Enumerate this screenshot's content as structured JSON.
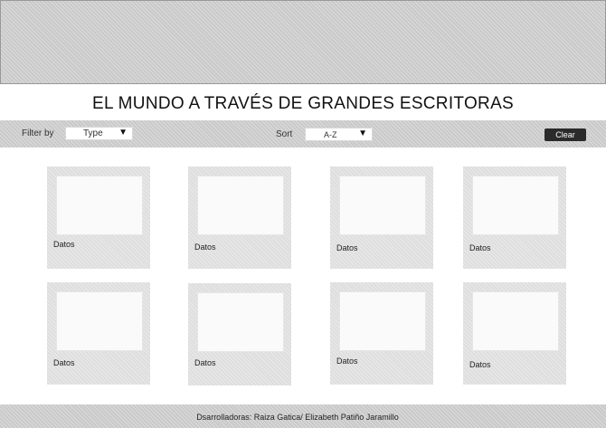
{
  "header": {
    "title": "EL MUNDO A TRAVÉS DE GRANDES ESCRITORAS"
  },
  "toolbar": {
    "filter_label": "Filter by",
    "filter_value": "Type",
    "sort_label": "Sort",
    "sort_value": "A-Z",
    "clear_label": "Clear"
  },
  "cards": [
    {
      "caption": "Datos"
    },
    {
      "caption": "Datos"
    },
    {
      "caption": "Datos"
    },
    {
      "caption": "Datos"
    },
    {
      "caption": "Datos"
    },
    {
      "caption": "Datos"
    },
    {
      "caption": "Datos"
    },
    {
      "caption": "Datos"
    }
  ],
  "footer": {
    "text": "Dsarrolladoras: Raiza Gatica/ Elizabeth Patiño Jaramillo"
  },
  "icons": {
    "dropdown": "triangle-down-icon"
  },
  "colors": {
    "clear_button": "#2b2b2b",
    "panel": "#c9c9c9",
    "card": "#dedede"
  }
}
